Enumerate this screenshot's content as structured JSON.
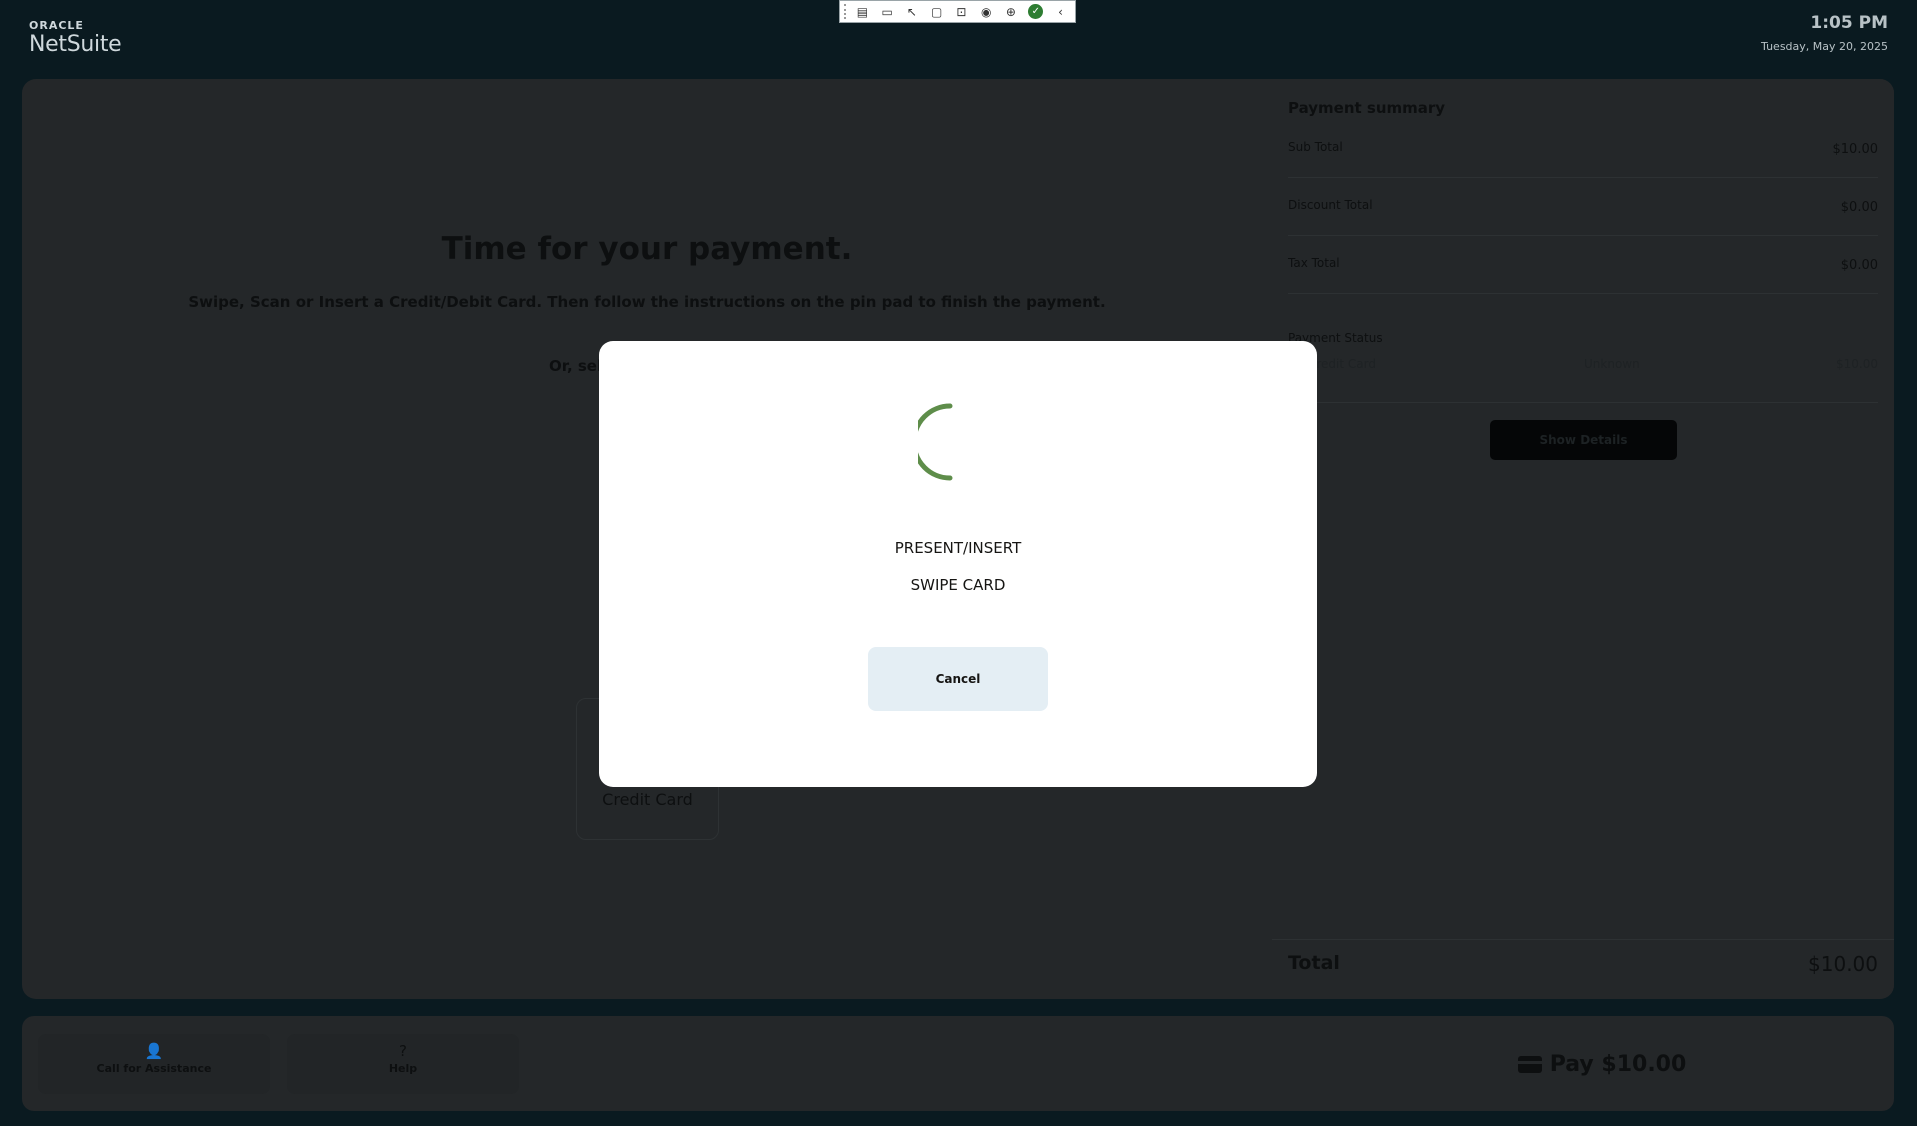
{
  "header": {
    "brand_top": "ORACLE",
    "brand_main": "NetSuite",
    "time": "1:05 PM",
    "date": "Tuesday, May 20, 2025"
  },
  "payment": {
    "title": "Time for your payment.",
    "instructions": "Swipe, Scan or Insert a Credit/Debit Card. Then follow the instructions on the pin pad to finish the payment.",
    "or_select": "Or, sel",
    "method_label": "Credit Card"
  },
  "summary": {
    "title": "Payment summary",
    "rows": [
      {
        "label": "Sub Total",
        "value": "$10.00"
      },
      {
        "label": "Discount Total",
        "value": "$0.00"
      },
      {
        "label": "Tax Total",
        "value": "$0.00"
      }
    ],
    "status_label": "Payment Status",
    "status_method": "Credit Card",
    "status_state": "Unknown",
    "status_amount": "$10.00",
    "show_details": "Show Details",
    "total_label": "Total",
    "total_value": "$10.00"
  },
  "footer": {
    "assist_label": "Call for Assistance",
    "help_label": "Help",
    "pay_label": "Pay $10.00"
  },
  "modal": {
    "line1": "PRESENT/INSERT",
    "line2": "SWIPE CARD",
    "cancel": "Cancel",
    "spinner_color": "#5e8d4a"
  },
  "colors": {
    "modal_bg": "#ffffff",
    "cancel_bg": "#e4eef4",
    "overlay_dim": "#242729"
  }
}
